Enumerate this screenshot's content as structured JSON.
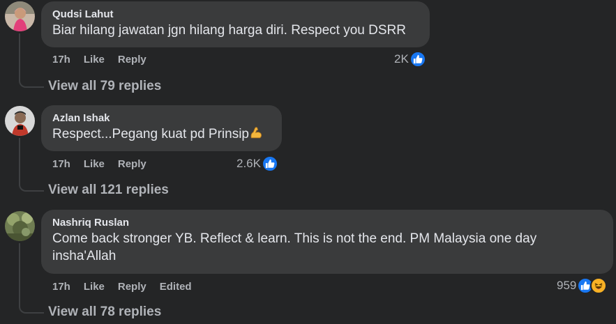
{
  "colors": {
    "background": "#242526",
    "bubble": "#3a3b3c",
    "primary_text": "#e4e6eb",
    "secondary_text": "#b0b3b8",
    "like_blue": "#1877f2",
    "haha_yellow": "#f7b125"
  },
  "comments": [
    {
      "author": "Qudsi Lahut",
      "text": "Biar hilang jawatan jgn hilang harga diri. Respect you DSRR",
      "time": "17h",
      "like_label": "Like",
      "reply_label": "Reply",
      "reaction_count": "2K",
      "reaction_icons": [
        "like-icon"
      ],
      "view_replies": "View all 79 replies"
    },
    {
      "author": "Azlan Ishak",
      "text": "Respect...Pegang kuat pd Prinsip",
      "text_emoji": "flexed-biceps-emoji",
      "time": "17h",
      "like_label": "Like",
      "reply_label": "Reply",
      "reaction_count": "2.6K",
      "reaction_icons": [
        "like-icon"
      ],
      "view_replies": "View all 121 replies"
    },
    {
      "author": "Nashriq Ruslan",
      "text_line1": "Come back stronger YB. Reflect & learn. This is not the end. PM Malaysia one day",
      "text_line2": "insha'Allah",
      "time": "17h",
      "like_label": "Like",
      "reply_label": "Reply",
      "edited_label": "Edited",
      "reaction_count": "959",
      "reaction_icons": [
        "like-icon",
        "haha-icon"
      ],
      "view_replies": "View all 78 replies"
    }
  ]
}
